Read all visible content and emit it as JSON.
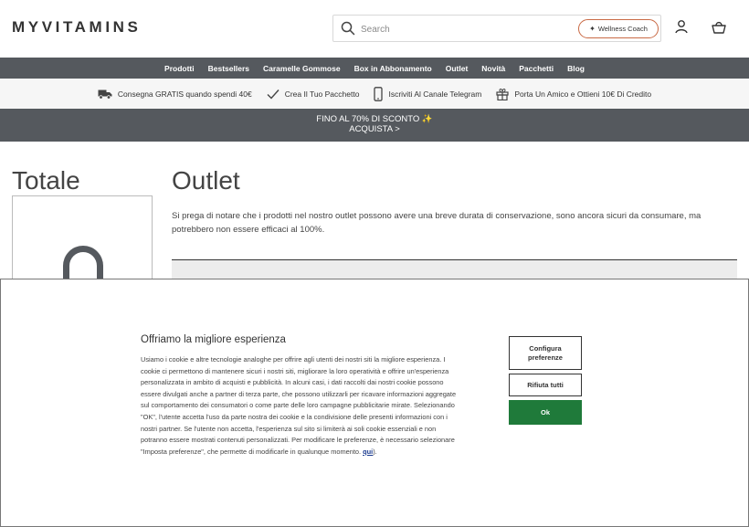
{
  "header": {
    "logo": "MYVITAMINS",
    "search_placeholder": "Search",
    "coach_label": "Wellness Coach"
  },
  "nav": {
    "items": [
      "Prodotti",
      "Bestsellers",
      "Caramelle Gommose",
      "Box in Abbonamento",
      "Outlet",
      "Novità",
      "Pacchetti",
      "Blog"
    ]
  },
  "perks": [
    {
      "icon": "truck-icon",
      "label": "Consegna GRATIS quando spendi 40€"
    },
    {
      "icon": "check-icon",
      "label": "Crea Il Tuo Pacchetto"
    },
    {
      "icon": "phone-icon",
      "label": "Iscriviti Al Canale Telegram"
    },
    {
      "icon": "gift-icon",
      "label": "Porta Un Amico e Ottieni 10€ Di Credito"
    }
  ],
  "promo": {
    "line1": "FINO AL 70% DI SCONTO ✨",
    "line2": "ACQUISTA >"
  },
  "main": {
    "sidebar_title": "Totale",
    "title": "Outlet",
    "description": "Si prega di notare che i prodotti nel nostro outlet possono avere una breve durata di conservazione, sono ancora sicuri da consumare, ma potrebbero non essere efficaci al 100%."
  },
  "cookie": {
    "title": "Offriamo la migliore esperienza",
    "text": "Usiamo i cookie e altre tecnologie analoghe per offrire agli utenti dei nostri siti la migliore esperienza. I cookie ci permettono di mantenere sicuri i nostri siti, migliorare la loro operatività e offrire un'esperienza personalizzata in ambito di acquisti e pubblicità. In alcuni casi, i dati raccolti dai nostri cookie possono essere divulgati anche a partner di terza parte, che possono utilizzarli per ricavare informazioni aggregate sul comportamento dei consumatori o come parte delle loro campagne pubblicitarie mirate. Selezionando \"OK\", l'utente accetta l'uso da parte nostra dei cookie e la condivisione delle presenti informazioni con i nostri partner. Se l'utente non accetta, l'esperienza sul sito si limiterà ai soli cookie essenziali e non potranno essere mostrati contenuti personalizzati. Per modificare le preferenze, è necessario selezionare \"Imposta preferenze\", che permette di modificarle in qualunque momento.",
    "link_label": "qui",
    "link_suffix": ").",
    "config_label": "Configura preferenze",
    "reject_label": "Rifiuta tutti",
    "ok_label": "Ok",
    "ok_color": "#1f7a3a"
  },
  "colors": {
    "nav_bg": "#55595e",
    "coach_border": "#c96a45"
  }
}
